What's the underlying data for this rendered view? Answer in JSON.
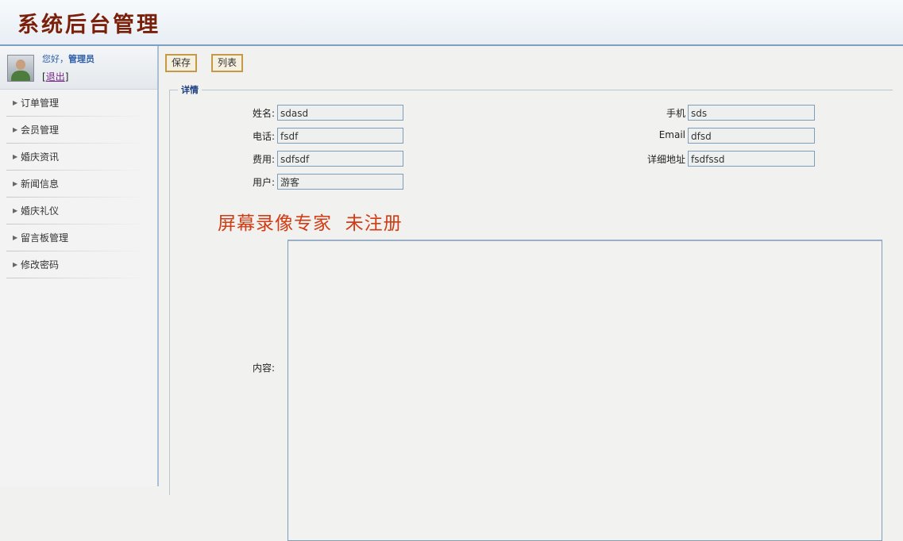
{
  "header": {
    "title": "系统后台管理"
  },
  "sidebar": {
    "greeting": "您好，",
    "username": "管理员",
    "logout_open": "[",
    "logout_label": "退出",
    "logout_close": "]",
    "menu": [
      {
        "label": "订单管理"
      },
      {
        "label": "会员管理"
      },
      {
        "label": "婚庆资讯"
      },
      {
        "label": "新闻信息"
      },
      {
        "label": "婚庆礼仪"
      },
      {
        "label": "留言板管理"
      },
      {
        "label": "修改密码"
      }
    ]
  },
  "toolbar": {
    "save_label": "保存",
    "list_label": "列表"
  },
  "form": {
    "legend": "详情",
    "name_label": "姓名:",
    "name_value": "sdasd",
    "phone_label": "电话:",
    "phone_value": "fsdf",
    "fee_label": "费用:",
    "fee_value": "sdfsdf",
    "user_label": "用户:",
    "user_value": "游客",
    "mobile_label": "手机",
    "mobile_value": "sds",
    "email_label": "Email",
    "email_value": "dfsd",
    "address_label": "详细地址",
    "address_value": "fsdfssd",
    "content_label": "内容:",
    "content_value": ""
  },
  "watermark": "屏幕录像专家  未注册",
  "icons": {
    "menu_arrow": "triangle-right-icon"
  },
  "colors": {
    "title": "#7a1f0a",
    "accent_border": "#7c9fc2",
    "button_border": "#c29a4a",
    "watermark": "#d13c14"
  }
}
